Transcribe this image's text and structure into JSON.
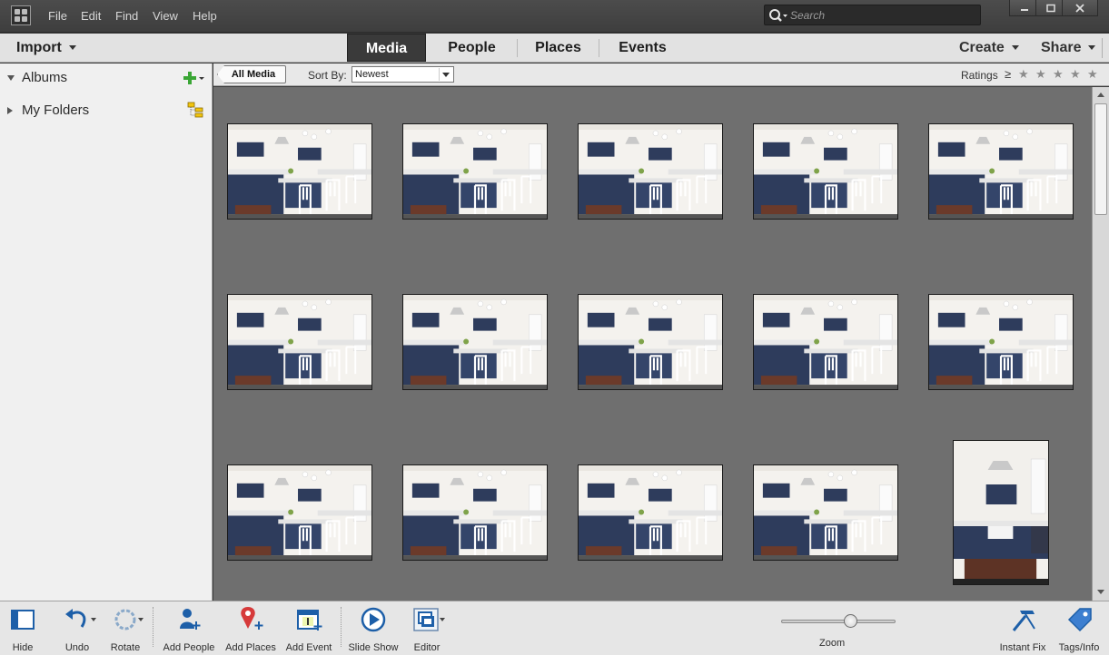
{
  "menu": {
    "items": [
      "File",
      "Edit",
      "Find",
      "View",
      "Help"
    ]
  },
  "search": {
    "placeholder": "Search"
  },
  "nav": {
    "import_label": "Import",
    "tabs": [
      "Media",
      "People",
      "Places",
      "Events"
    ],
    "active_tab": "Media",
    "create_label": "Create",
    "share_label": "Share"
  },
  "sidebar": {
    "albums_label": "Albums",
    "folders_label": "My Folders"
  },
  "filter": {
    "all_media_label": "All Media",
    "sort_label": "Sort By:",
    "sort_value": "Newest",
    "ratings_label": "Ratings",
    "ratings_op": "≥",
    "stars": [
      "★",
      "★",
      "★",
      "★",
      "★"
    ]
  },
  "toolbar": {
    "hide": "Hide",
    "undo": "Undo",
    "rotate": "Rotate",
    "add_people": "Add People",
    "add_places": "Add Places",
    "add_event": "Add Event",
    "slide_show": "Slide Show",
    "editor": "Editor",
    "zoom": "Zoom",
    "instant_fix": "Instant Fix",
    "tags_info": "Tags/Info"
  },
  "zoom_level": 0.6,
  "grid": {
    "thumbnail_count": 15,
    "accent_color": "#ffffff",
    "cabinet_color": "#2e3c5c",
    "background_color": "#6f6f6f"
  }
}
